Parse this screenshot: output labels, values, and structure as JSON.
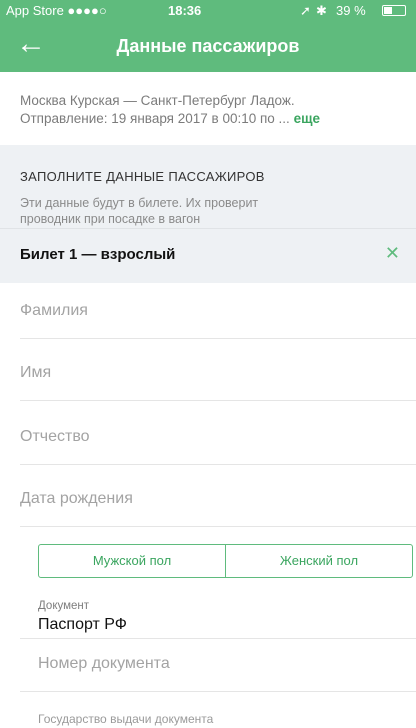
{
  "status_bar": {
    "carrier": "App Store ●●●●○",
    "time": "18:36",
    "battery": "39 %"
  },
  "nav": {
    "back_icon": "arrow-left-icon",
    "title": "Данные пассажиров"
  },
  "route": {
    "line1": "Москва Курская — Санкт-Петербург Ладож.",
    "line2": "Отправление: 19 января 2017 в 00:10  по ...",
    "more": "еще"
  },
  "info": {
    "heading": "ЗАПОЛНИТЕ ДАННЫЕ ПАССАЖИРОВ",
    "desc_line1": "Эти данные будут в билете. Их проверит",
    "desc_line2": "проводник при посадке в вагон"
  },
  "ticket": {
    "label": "Билет 1 — взрослый"
  },
  "fields": {
    "surname": "Фамилия",
    "name": "Имя",
    "patronymic": "Отчество",
    "birth_date": "Дата рождения"
  },
  "gender": {
    "male": "Мужской пол",
    "female": "Женский пол"
  },
  "document": {
    "label": "Документ",
    "value": "Паспорт РФ",
    "number_placeholder": "Номер документа",
    "country_label": "Государство выдачи документа"
  },
  "colors": {
    "accent": "#5fbb7d",
    "panel_bg": "#eef1f4"
  }
}
